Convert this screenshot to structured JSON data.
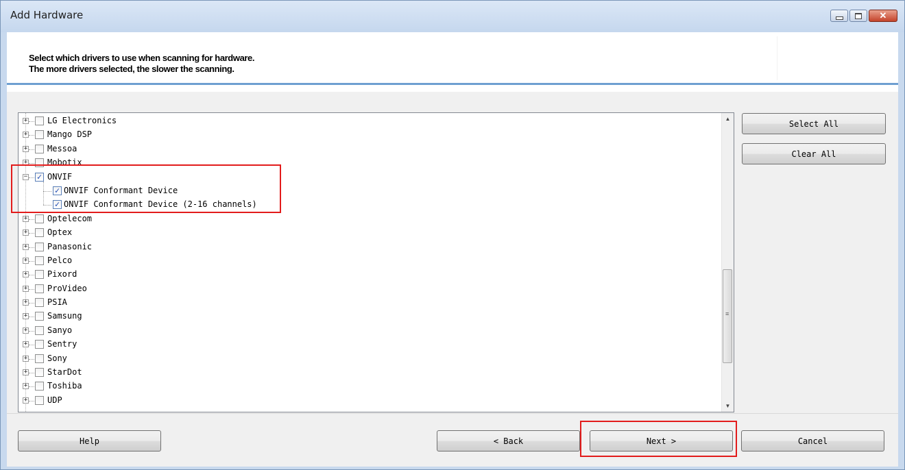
{
  "window": {
    "title": "Add Hardware",
    "controls": [
      "minimize",
      "maximize",
      "close"
    ],
    "close_glyph": "✕"
  },
  "header": {
    "line1": "Select which drivers to use when scanning for hardware.",
    "line2": "The more drivers selected, the slower the scanning."
  },
  "tree": {
    "items": [
      {
        "label": "LG Electronics",
        "checked": false,
        "expander": "+"
      },
      {
        "label": "Mango DSP",
        "checked": false,
        "expander": "+"
      },
      {
        "label": "Messoa",
        "checked": false,
        "expander": "+"
      },
      {
        "label": "Mobotix",
        "checked": false,
        "expander": "+"
      },
      {
        "label": "ONVIF",
        "checked": true,
        "expander": "−"
      },
      {
        "label": "ONVIF Conformant Device",
        "checked": true,
        "child": true
      },
      {
        "label": "ONVIF Conformant Device (2-16 channels)",
        "checked": true,
        "child": true
      },
      {
        "label": "Optelecom",
        "checked": false,
        "expander": "+"
      },
      {
        "label": "Optex",
        "checked": false,
        "expander": "+"
      },
      {
        "label": "Panasonic",
        "checked": false,
        "expander": "+"
      },
      {
        "label": "Pelco",
        "checked": false,
        "expander": "+"
      },
      {
        "label": "Pixord",
        "checked": false,
        "expander": "+"
      },
      {
        "label": "ProVideo",
        "checked": false,
        "expander": "+"
      },
      {
        "label": "PSIA",
        "checked": false,
        "expander": "+"
      },
      {
        "label": "Samsung",
        "checked": false,
        "expander": "+"
      },
      {
        "label": "Sanyo",
        "checked": false,
        "expander": "+"
      },
      {
        "label": "Sentry",
        "checked": false,
        "expander": "+"
      },
      {
        "label": "Sony",
        "checked": false,
        "expander": "+"
      },
      {
        "label": "StarDot",
        "checked": false,
        "expander": "+"
      },
      {
        "label": "Toshiba",
        "checked": false,
        "expander": "+"
      },
      {
        "label": "UDP",
        "checked": false,
        "expander": "+"
      }
    ],
    "scroll_up": "▲",
    "scroll_down": "▼",
    "scroll_grip": "≡"
  },
  "side_buttons": {
    "select_all": "Select All",
    "clear_all": "Clear All"
  },
  "footer": {
    "help": "Help",
    "back": "< Back",
    "next": "Next >",
    "cancel": "Cancel"
  },
  "colors": {
    "highlight": "#e21b1b",
    "header_rule": "#6e9fd1",
    "check": "#1f4bb4"
  }
}
